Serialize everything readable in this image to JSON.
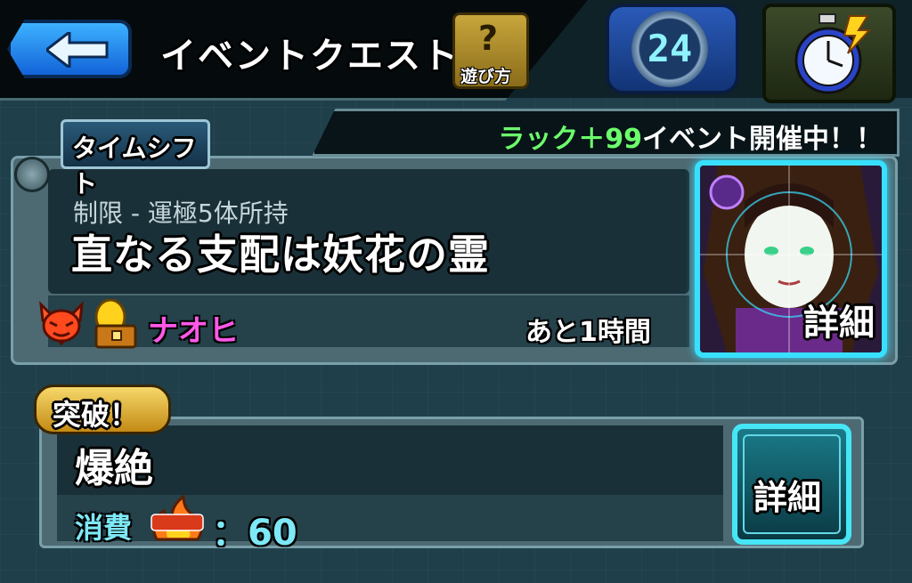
{
  "header": {
    "title": "イベントクエスト",
    "help_label": "遊び方",
    "help_symbol": "?",
    "counter_value": "24"
  },
  "event": {
    "banner_highlight": "ラック＋99",
    "banner_rest": "イベント開催中！！",
    "tag": "タイムシフト",
    "restriction": "制限 - 運極5体所持",
    "quest_name": "直なる支配は妖花の霊",
    "boss_name": "ナオヒ",
    "time_remaining": "あと1時間",
    "portrait_detail": "詳細"
  },
  "breakthrough": {
    "tag": "突破！",
    "difficulty": "爆絶",
    "cost_label": "消費",
    "stamina_cost": "：60",
    "detail_button": "詳細"
  },
  "icons": {
    "back": "back-arrow-icon",
    "help": "question-icon",
    "timer": "stopwatch-lightning-icon",
    "attribute": "demon-icon",
    "reward": "egg-chest-icon",
    "stamina": "stamina-flame-icon"
  },
  "colors": {
    "luck_green": "#6cff6c",
    "boss_name_pink": "#ff58e8",
    "cost_cyan": "#7ee8f6",
    "portrait_border": "#38e0ff"
  }
}
